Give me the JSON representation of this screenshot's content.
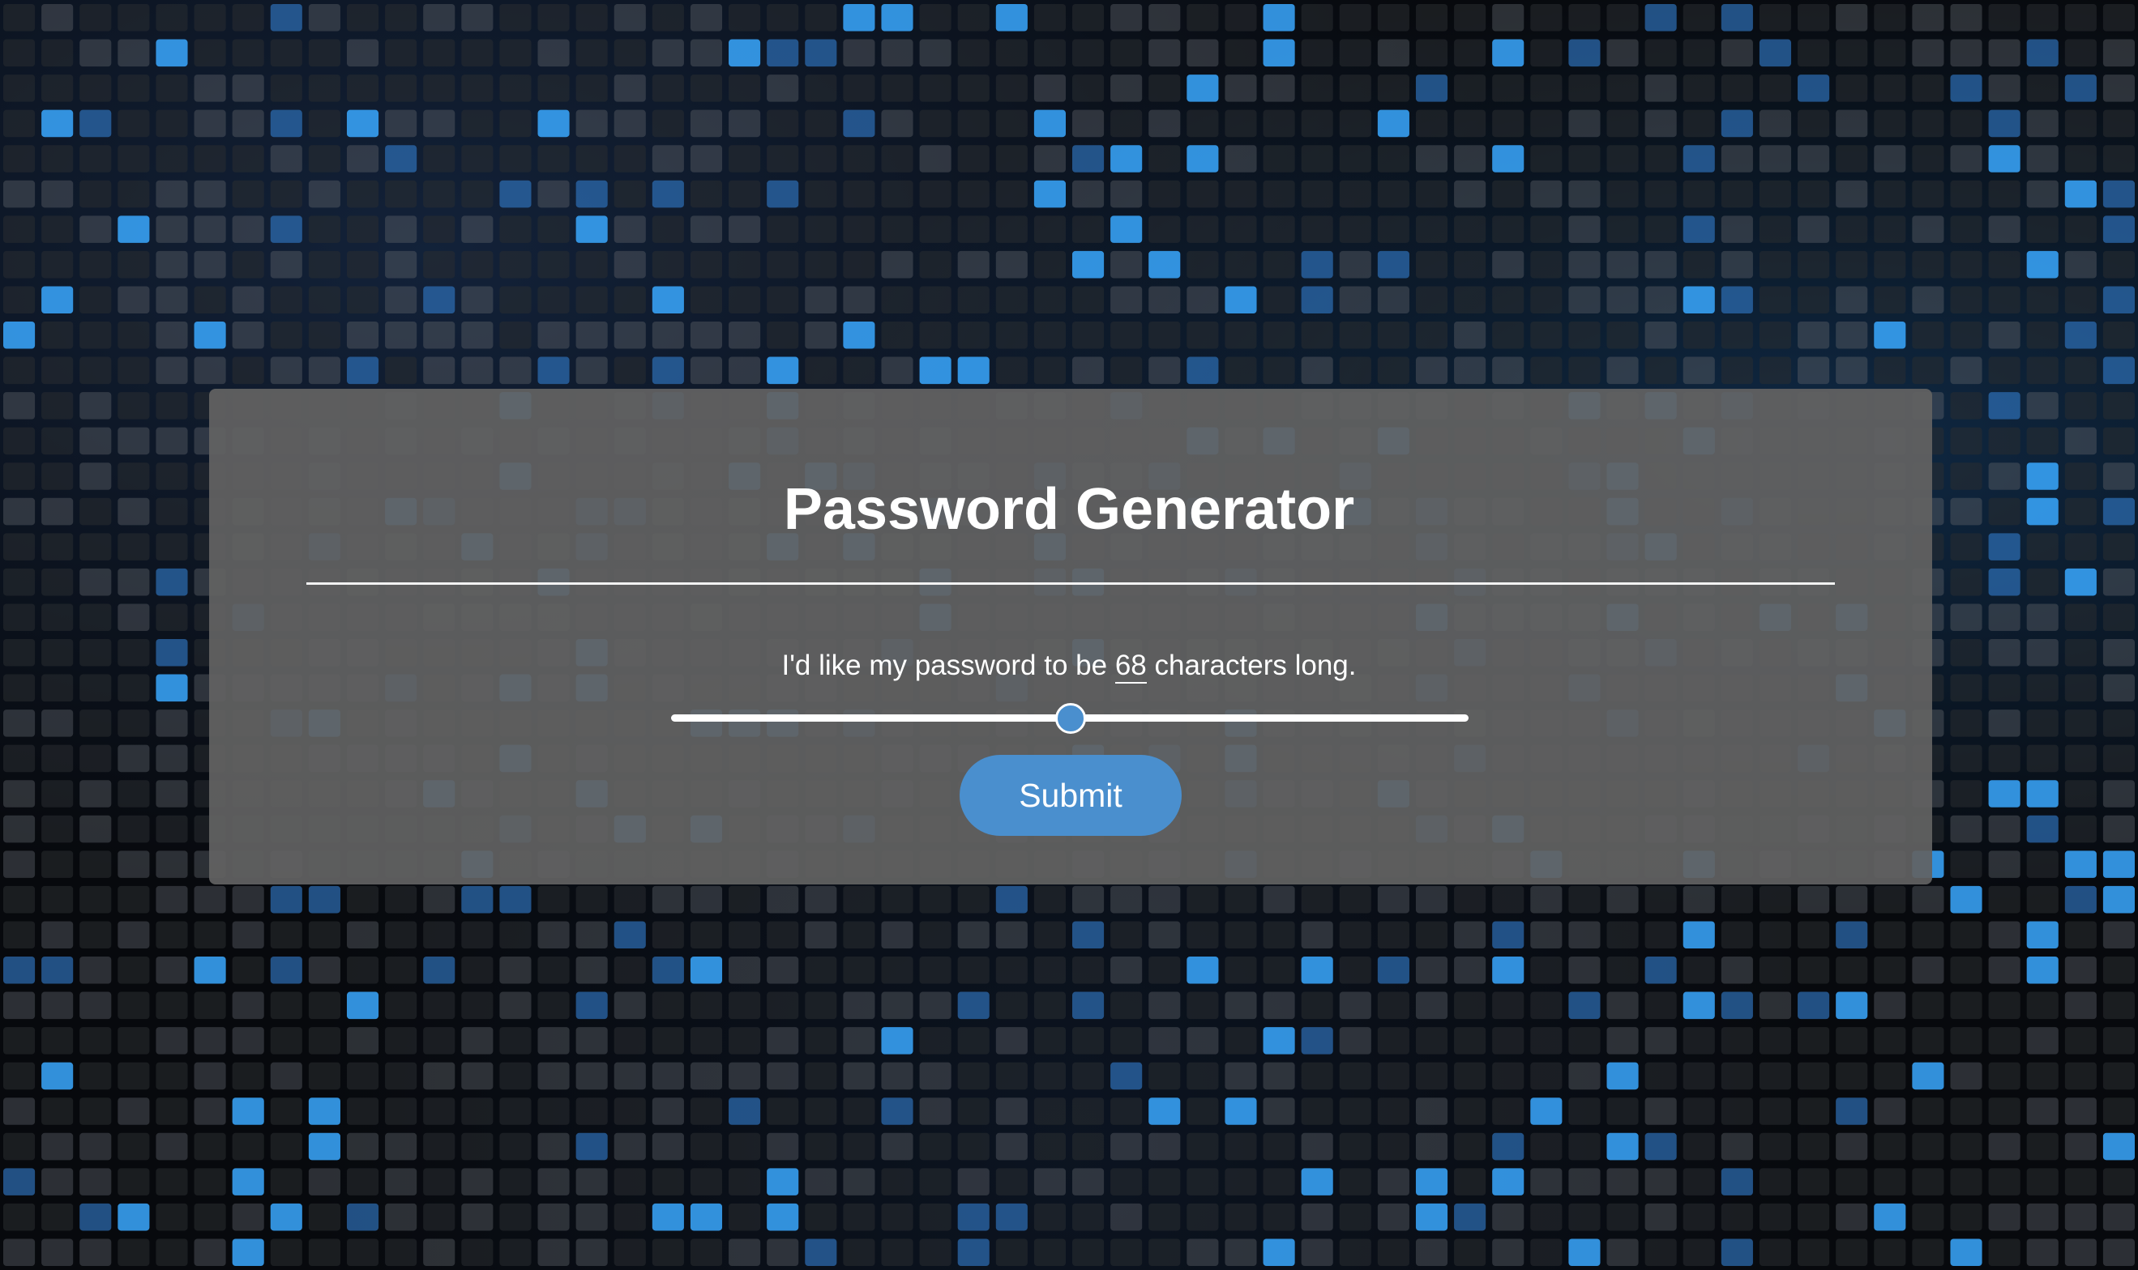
{
  "page": {
    "title": "Password Generator"
  },
  "form": {
    "length_prefix": "I'd like my password to be ",
    "length_value": "68",
    "length_suffix": " characters long.",
    "slider": {
      "value": 68,
      "min": 8,
      "max": 128
    },
    "submit_label": "Submit"
  },
  "colors": {
    "accent": "#4a8fce",
    "card_background": "#626262",
    "text": "#ffffff"
  }
}
